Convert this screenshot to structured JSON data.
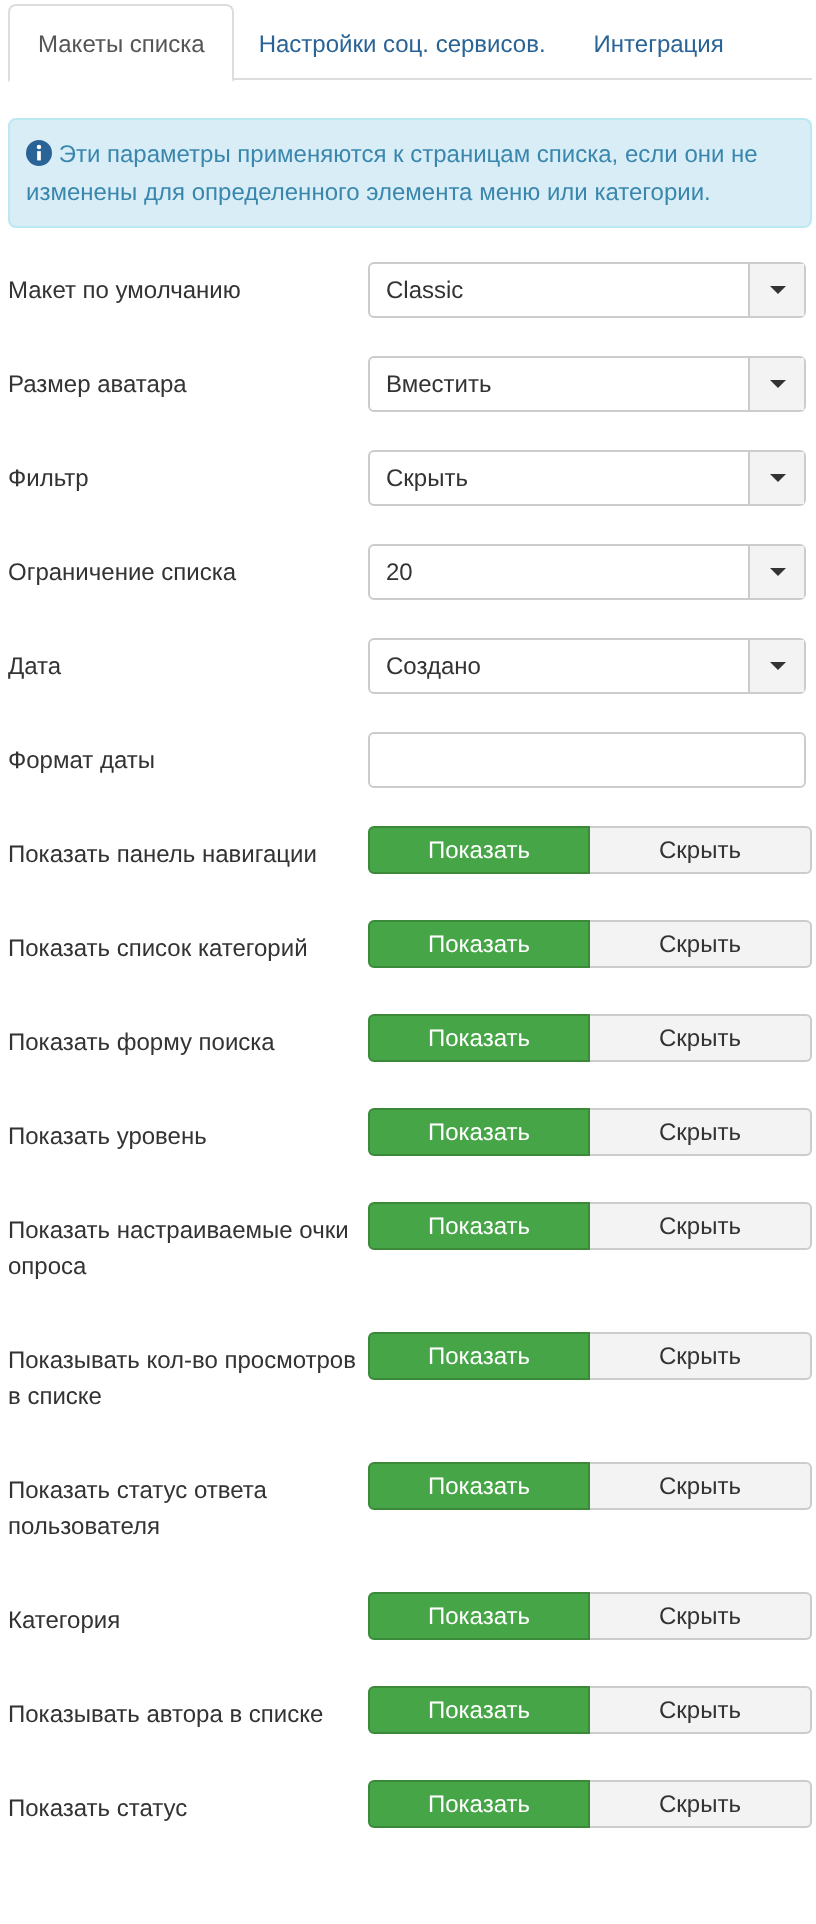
{
  "tabs": [
    {
      "label": "Макеты списка",
      "selected": true
    },
    {
      "label": "Настройки соц. сервисов.",
      "selected": false
    },
    {
      "label": "Интеграция",
      "selected": false
    }
  ],
  "info": "Эти параметры применяются к страницам списка, если они не изменены для определенного элемента меню или категории.",
  "fields": [
    {
      "kind": "select",
      "label": "Макет по умолчанию",
      "value": "Classic"
    },
    {
      "kind": "select",
      "label": "Размер аватара",
      "value": "Вместить"
    },
    {
      "kind": "select",
      "label": "Фильтр",
      "value": "Скрыть"
    },
    {
      "kind": "select",
      "label": "Ограничение списка",
      "value": "20"
    },
    {
      "kind": "select",
      "label": "Дата",
      "value": "Создано"
    },
    {
      "kind": "text",
      "label": "Формат даты"
    },
    {
      "kind": "toggle",
      "label": "Показать панель навигации",
      "options": [
        {
          "label": "Показать",
          "selected": true
        },
        {
          "label": "Скрыть",
          "selected": false
        }
      ]
    },
    {
      "kind": "toggle",
      "label": "Показать список категорий",
      "options": [
        {
          "label": "Показать",
          "selected": true
        },
        {
          "label": "Скрыть",
          "selected": false
        }
      ]
    },
    {
      "kind": "toggle",
      "label": "Показать форму поиска",
      "options": [
        {
          "label": "Показать",
          "selected": true
        },
        {
          "label": "Скрыть",
          "selected": false
        }
      ]
    },
    {
      "kind": "toggle",
      "label": "Показать уровень",
      "options": [
        {
          "label": "Показать",
          "selected": true
        },
        {
          "label": "Скрыть",
          "selected": false
        }
      ]
    },
    {
      "kind": "toggle",
      "label": "Показать настраиваемые очки опроса",
      "options": [
        {
          "label": "Показать",
          "selected": true
        },
        {
          "label": "Скрыть",
          "selected": false
        }
      ]
    },
    {
      "kind": "toggle",
      "label": "Показывать кол-во просмотров в списке",
      "options": [
        {
          "label": "Показать",
          "selected": true
        },
        {
          "label": "Скрыть",
          "selected": false
        }
      ]
    },
    {
      "kind": "toggle",
      "label": "Показать статус ответа пользователя",
      "options": [
        {
          "label": "Показать",
          "selected": true
        },
        {
          "label": "Скрыть",
          "selected": false
        }
      ]
    },
    {
      "kind": "toggle",
      "label": "Категория",
      "options": [
        {
          "label": "Показать",
          "selected": true
        },
        {
          "label": "Скрыть",
          "selected": false
        }
      ]
    },
    {
      "kind": "toggle",
      "label": "Показывать автора в списке",
      "options": [
        {
          "label": "Показать",
          "selected": true
        },
        {
          "label": "Скрыть",
          "selected": false
        }
      ]
    },
    {
      "kind": "toggle",
      "label": "Показать статус",
      "options": [
        {
          "label": "Показать",
          "selected": true
        },
        {
          "label": "Скрыть",
          "selected": false
        }
      ]
    }
  ]
}
